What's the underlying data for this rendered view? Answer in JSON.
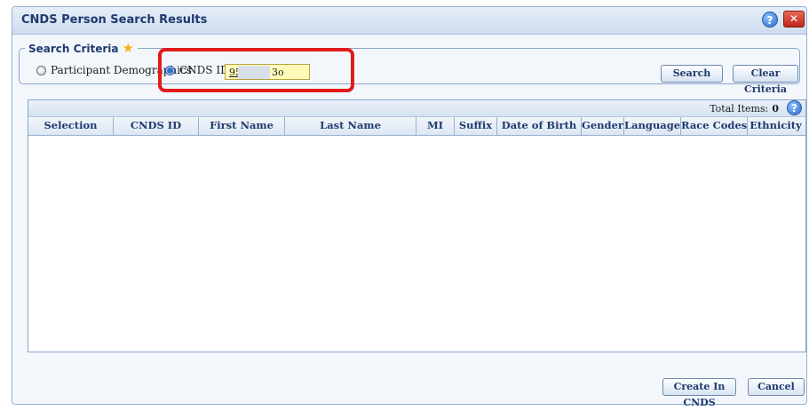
{
  "dialog": {
    "title": "CNDS Person Search Results",
    "help_icon": "help-icon",
    "close_icon": "close-icon",
    "close_glyph": "✕",
    "help_glyph": "?"
  },
  "criteria": {
    "legend": "Search Criteria",
    "star_icon": "star-icon",
    "options": [
      {
        "label": "Participant Demographics",
        "checked": false
      },
      {
        "label": "CNDS ID",
        "checked": true
      }
    ],
    "cnds_id_value_start": "95",
    "cnds_id_value_end": "3o",
    "search_label": "Search",
    "clear_label": "Clear Criteria"
  },
  "results": {
    "total_label": "Total Items:",
    "total_value": "0",
    "columns": [
      "Selection",
      "CNDS ID",
      "First Name",
      "Last Name",
      "MI",
      "Suffix",
      "Date of Birth",
      "Gender",
      "Language",
      "Race Codes",
      "Ethnicity"
    ],
    "rows": []
  },
  "footer": {
    "create_label": "Create In CNDS",
    "cancel_label": "Cancel"
  },
  "colors": {
    "title_text": "#1f3a6e",
    "highlight": "#e11a1a",
    "input_bg": "#fffab8"
  }
}
